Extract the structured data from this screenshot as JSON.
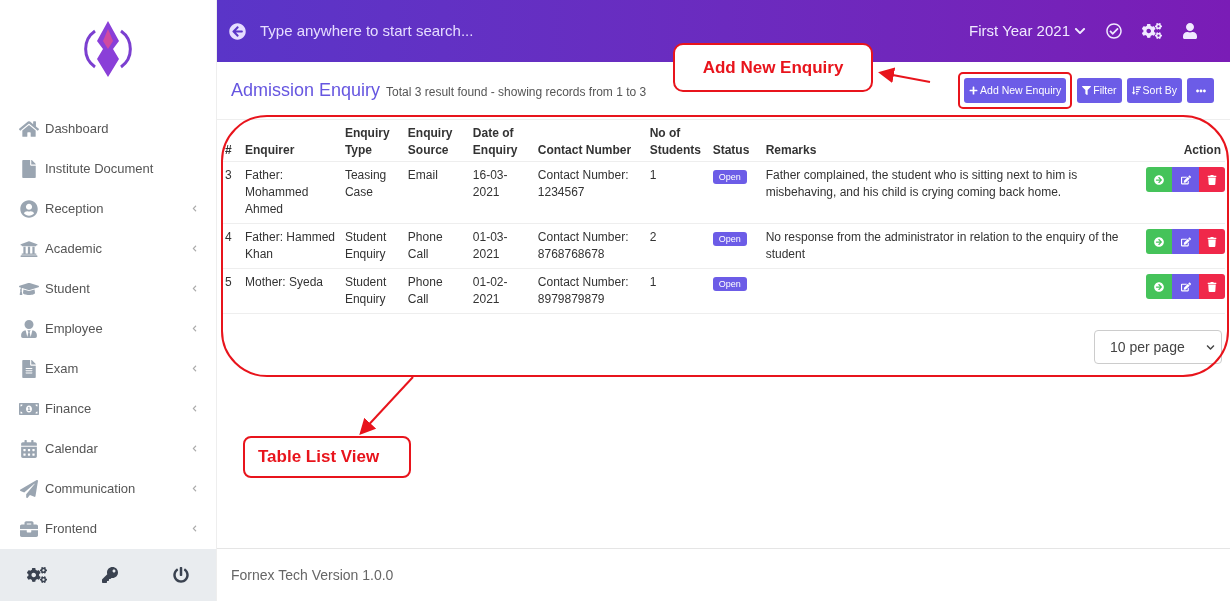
{
  "sidebar": {
    "items": [
      {
        "label": "Dashboard",
        "expandable": false
      },
      {
        "label": "Institute Document",
        "expandable": false
      },
      {
        "label": "Reception",
        "expandable": true
      },
      {
        "label": "Academic",
        "expandable": true
      },
      {
        "label": "Student",
        "expandable": true
      },
      {
        "label": "Employee",
        "expandable": true
      },
      {
        "label": "Exam",
        "expandable": true
      },
      {
        "label": "Finance",
        "expandable": true
      },
      {
        "label": "Calendar",
        "expandable": true
      },
      {
        "label": "Communication",
        "expandable": true
      },
      {
        "label": "Frontend",
        "expandable": true
      }
    ]
  },
  "topbar": {
    "search": {
      "placeholder": "Type anywhere to start search..."
    },
    "session": "First Year 2021"
  },
  "page": {
    "title": "Admission Enquiry",
    "summary": "Total 3 result found - showing records from 1 to 3",
    "buttons": [
      {
        "label": "Add New Enquiry"
      },
      {
        "label": "Filter"
      },
      {
        "label": "Sort By"
      }
    ]
  },
  "table": {
    "columns": [
      "#",
      "Enquirer",
      "Enquiry Type",
      "Enquiry Source",
      "Date of Enquiry",
      "Contact Number",
      "No of Students",
      "Status",
      "Remarks",
      "Action"
    ],
    "rows": [
      {
        "number": "3",
        "enquirer": "Father: Mohammed Ahmed",
        "type": "Teasing Case",
        "source": "Email",
        "date": "16-03-2021",
        "contact": "Contact Number: 1234567",
        "students": "1",
        "status": "Open",
        "remarks": "Father complained, the student who is sitting next to him is misbehaving, and his child is crying coming back home."
      },
      {
        "number": "4",
        "enquirer": "Father: Hammed Khan",
        "type": "Student Enquiry",
        "source": "Phone Call",
        "date": "01-03-2021",
        "contact": "Contact Number: 8768768678",
        "students": "2",
        "status": "Open",
        "remarks": "No response from the administrator in relation to the enquiry of the student"
      },
      {
        "number": "5",
        "enquirer": "Mother: Syeda",
        "type": "Student Enquiry",
        "source": "Phone Call",
        "date": "01-02-2021",
        "contact": "Contact Number: 8979879879",
        "students": "1",
        "status": "Open"
      }
    ]
  },
  "pagination": {
    "per_page": "10 per page"
  },
  "footer": {
    "text": "Fornex Tech Version 1.0.0"
  },
  "annotations": [
    {
      "text": "Add New Enquiry"
    },
    {
      "text": "Table List View"
    }
  ]
}
